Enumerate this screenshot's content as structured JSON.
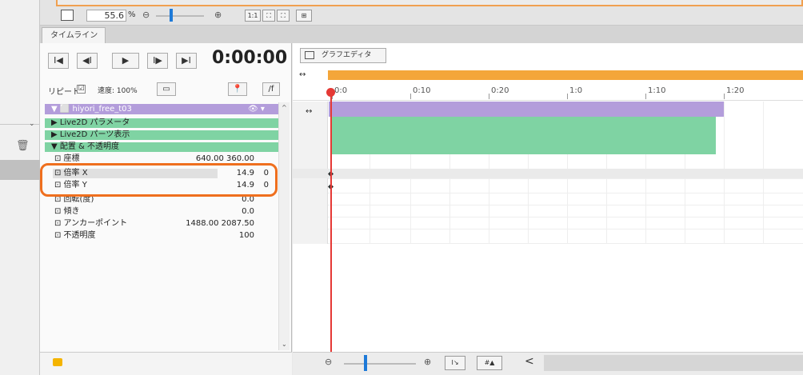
{
  "viewer": {
    "zoom_value": "55.6",
    "zoom_unit": "%",
    "zoom_out_icon": "⊖",
    "zoom_in_icon": "⊕",
    "btn_1to1": "1:1",
    "btn_fit": "⛶",
    "btn_grid": "⊞"
  },
  "tabs": {
    "timeline": "タイムライン"
  },
  "transport": {
    "to_start": "I◀",
    "prev_frame": "◀I",
    "play": "▶",
    "next_frame": "I▶",
    "to_end": "▶I",
    "time": "0:00:00"
  },
  "options": {
    "repeat_label": "リピート",
    "repeat_checked": "☑",
    "speed_label": "速度: 100%",
    "btn_a": "▭",
    "btn_pin": "📍",
    "btn_curve": "/f"
  },
  "tracks": {
    "model_name": "hiyori_free_t03",
    "group1": "▶ Live2D パラメータ",
    "group2": "▶ Live2D パーツ表示",
    "group3": "▼ 配置 & 不透明度",
    "rows": [
      {
        "label": "⊡ 座標",
        "value": "640.00  360.00"
      },
      {
        "label": "⊡ 倍率 X",
        "value": "14.9"
      },
      {
        "label": "⊡ 倍率 Y",
        "value": "14.9"
      },
      {
        "label": "⊡ 回転(度)",
        "value": "0.0"
      },
      {
        "label": "⊡ 傾き",
        "value": "0.0"
      },
      {
        "label": "⊡ アンカーポイント",
        "value": "1488.00  2087.50"
      },
      {
        "label": "⊡ 不透明度",
        "value": "100"
      }
    ],
    "lock_x": "0",
    "lock_y": "0"
  },
  "timeline": {
    "graph_editor": "グラフエディタ",
    "expand_icon": "↔",
    "ticks": [
      "0:0",
      "0:10",
      "0:20",
      "1:0",
      "1:10",
      "1:20"
    ],
    "row_icon": "↔"
  },
  "bottom": {
    "zoom_out": "⊖",
    "zoom_in": "⊕",
    "btn_a": "I↘",
    "btn_b": "#▲",
    "scroll_left": "<"
  },
  "colors": {
    "accent": "#1e7ad8",
    "highlight": "#ef6f1e",
    "model_track": "#b39ddb",
    "group_track": "#7fd3a3",
    "playhead": "#e53935",
    "work_area": "#f4a63a"
  }
}
